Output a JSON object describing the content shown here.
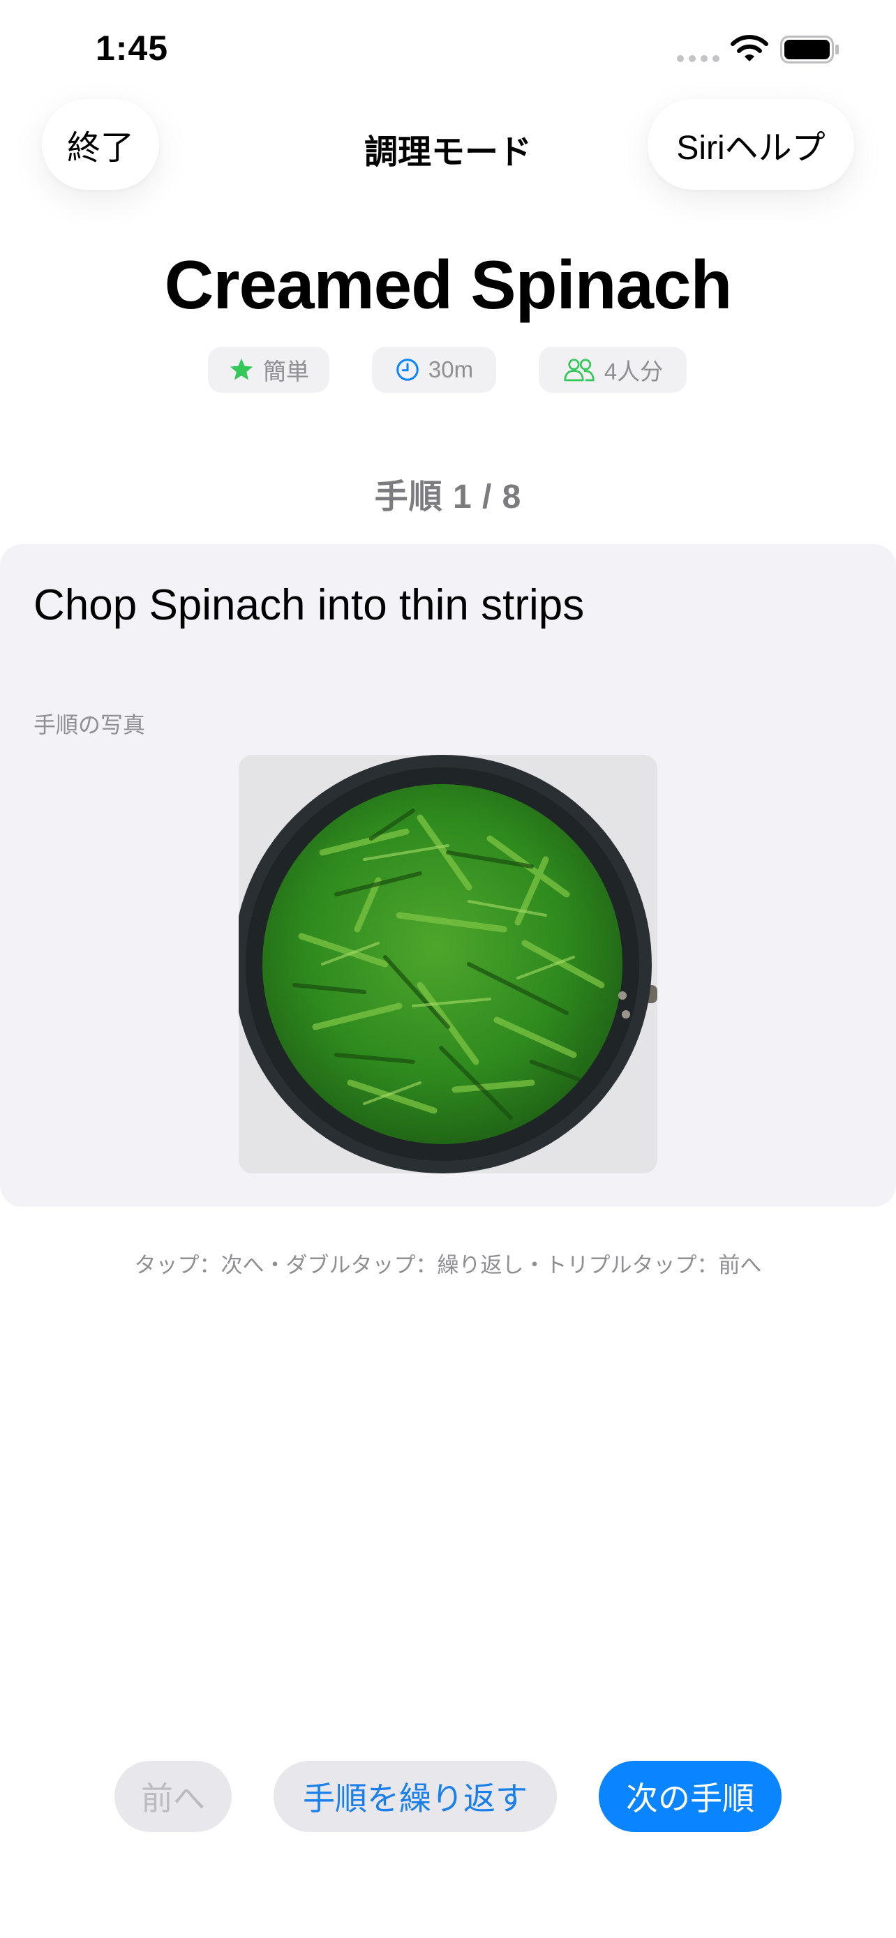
{
  "status_bar": {
    "time": "1:45"
  },
  "nav": {
    "exit_label": "終了",
    "title": "調理モード",
    "siri_label": "Siriヘルプ"
  },
  "recipe": {
    "title": "Creamed Spinach",
    "difficulty": "簡単",
    "time": "30m",
    "servings": "4人分"
  },
  "step": {
    "counter": "手順 1 / 8",
    "instruction": "Chop Spinach into thin strips",
    "photo_label": "手順の写真"
  },
  "gesture_hint": "タップ：次へ・ダブルタップ：繰り返し・トリプルタップ：前へ",
  "controls": {
    "prev_label": "前へ",
    "repeat_label": "手順を繰り返す",
    "next_label": "次の手順"
  },
  "colors": {
    "accent": "#0a84ff",
    "difficulty_star": "#34c759",
    "time_icon": "#0a84ff",
    "servings_icon": "#34c759",
    "card_background": "#f2f2f7"
  },
  "icons": {
    "difficulty": "star-icon",
    "time": "clock-icon",
    "servings": "people-icon"
  }
}
